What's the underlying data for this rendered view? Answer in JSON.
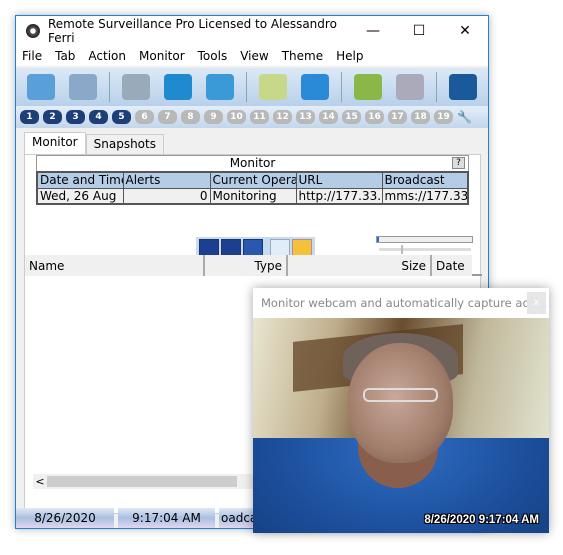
{
  "window": {
    "title": "Remote Surveillance Pro Licensed to Alessandro Ferri",
    "minimize": "—",
    "maximize": "☐",
    "close": "✕"
  },
  "menu": [
    "File",
    "Tab",
    "Action",
    "Monitor",
    "Tools",
    "View",
    "Theme",
    "Help"
  ],
  "toolbar": [
    {
      "name": "inbox-icon",
      "color": "#5aa0d8"
    },
    {
      "name": "media-icon",
      "color": "#8aa8c8"
    },
    {
      "name": "camera-icon",
      "color": "#9ab"
    },
    {
      "name": "windows-icon",
      "color": "#1f8ad0"
    },
    {
      "name": "webcam-icon",
      "color": "#3a9ad8"
    },
    {
      "name": "mail-icon",
      "color": "#c8d88a"
    },
    {
      "name": "globe-upload-icon",
      "color": "#2a8ad8"
    },
    {
      "name": "book-icon",
      "color": "#8ab848"
    },
    {
      "name": "gears-icon",
      "color": "#aab"
    },
    {
      "name": "help-book-icon",
      "color": "#1a5a9a"
    }
  ],
  "tab_numbers": [
    {
      "n": "1",
      "on": true
    },
    {
      "n": "2",
      "on": true
    },
    {
      "n": "3",
      "on": true
    },
    {
      "n": "4",
      "on": true
    },
    {
      "n": "5",
      "on": true
    },
    {
      "n": "6",
      "on": false
    },
    {
      "n": "7",
      "on": false
    },
    {
      "n": "8",
      "on": false
    },
    {
      "n": "9",
      "on": false
    },
    {
      "n": "10",
      "on": false
    },
    {
      "n": "11",
      "on": false
    },
    {
      "n": "12",
      "on": false
    },
    {
      "n": "13",
      "on": false
    },
    {
      "n": "14",
      "on": false
    },
    {
      "n": "15",
      "on": false
    },
    {
      "n": "16",
      "on": false
    },
    {
      "n": "17",
      "on": false
    },
    {
      "n": "18",
      "on": false
    },
    {
      "n": "19",
      "on": false
    }
  ],
  "tabs": {
    "monitor": "Monitor",
    "snapshots": "Snapshots"
  },
  "monitor": {
    "title": "Monitor",
    "help": "?",
    "headers": [
      "Date and Time",
      "Alerts",
      "Current Operation",
      "URL",
      "Broadcast"
    ],
    "row": [
      "Wed,  26 Aug",
      "0",
      "Monitoring",
      "http://177.33.",
      "mms://177.33"
    ],
    "progress": 0.02
  },
  "list": {
    "headers": [
      "Name",
      "Type",
      "Size",
      "Date"
    ]
  },
  "scroll": {
    "left": "<"
  },
  "status": {
    "date": "8/26/2020",
    "time": "9:17:04 AM",
    "broadcast": "oadcas"
  },
  "popup": {
    "title": "Monitor webcam and automatically capture acti...",
    "close": "x",
    "timestamp": "8/26/2020 9:17:04 AM"
  }
}
